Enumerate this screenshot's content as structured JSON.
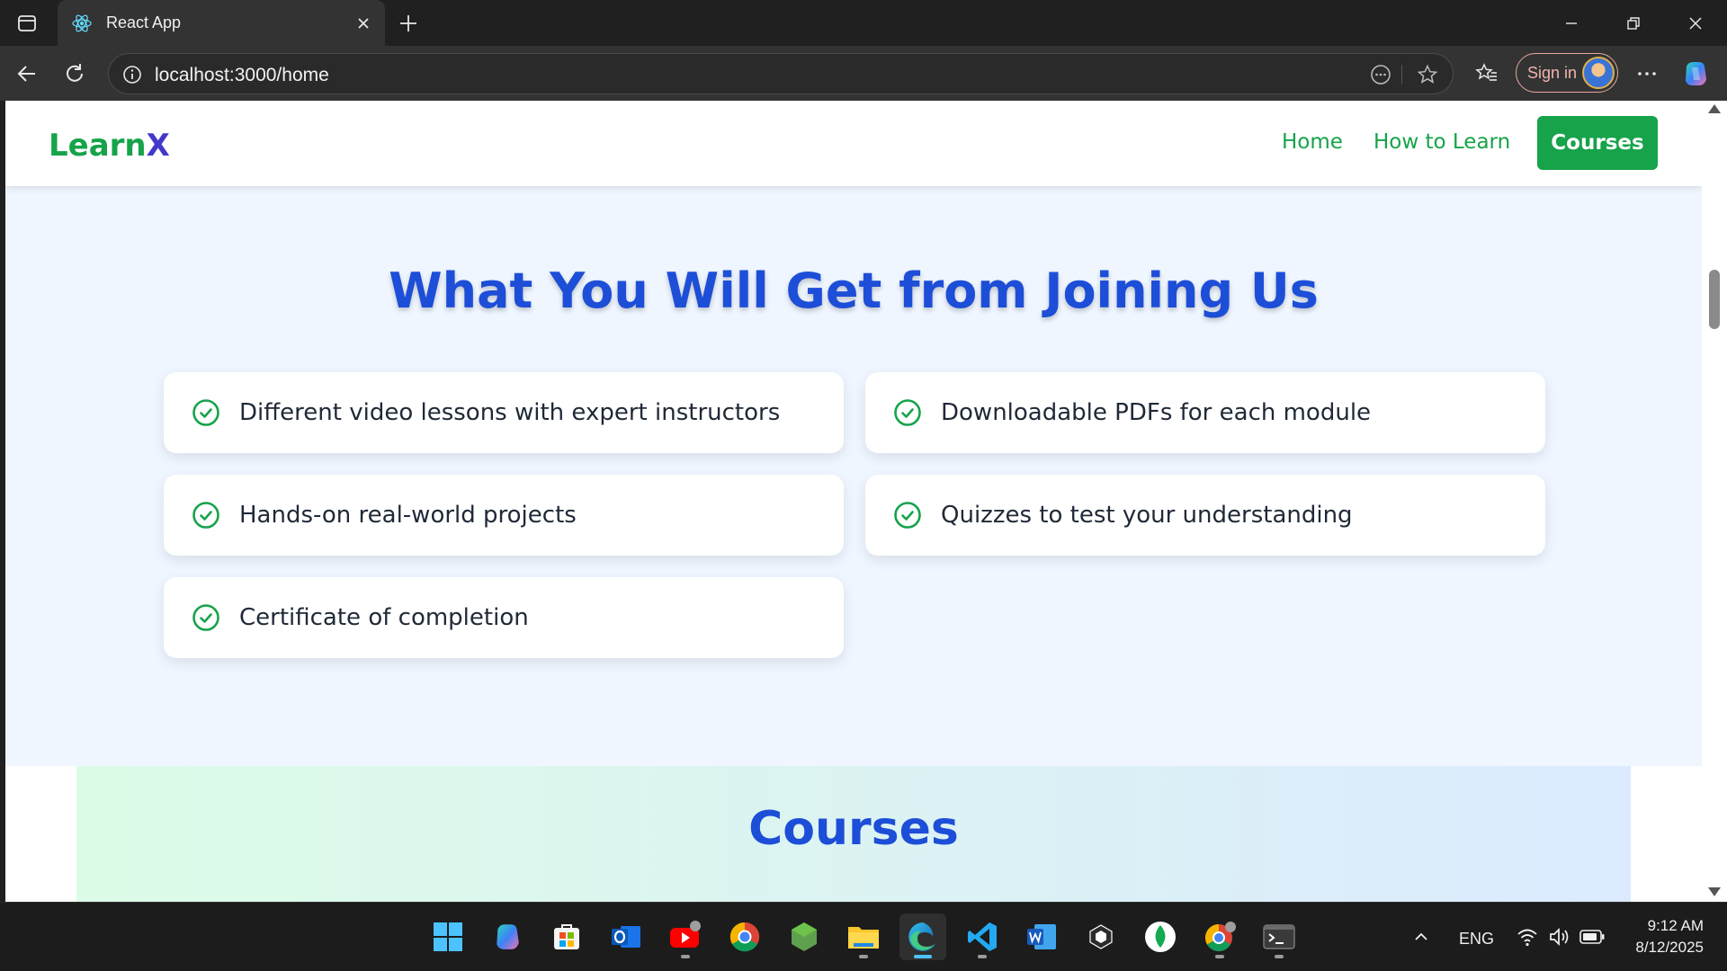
{
  "browser": {
    "tab_title": "React App",
    "url": "localhost:3000/home",
    "signin_label": "Sign in"
  },
  "navbar": {
    "logo_part1": "Learn",
    "logo_part2": "X",
    "links": [
      {
        "label": "Home"
      },
      {
        "label": "How to Learn"
      }
    ],
    "cta_label": "Courses"
  },
  "benefits": {
    "title": "What You Will Get from Joining Us",
    "items": [
      {
        "text": "Different video lessons with expert instructors"
      },
      {
        "text": "Downloadable PDFs for each module"
      },
      {
        "text": "Hands-on real-world projects"
      },
      {
        "text": "Quizzes to test your understanding"
      },
      {
        "text": "Certificate of completion"
      }
    ]
  },
  "courses": {
    "title": "Courses"
  },
  "taskbar": {
    "language": "ENG",
    "time": "9:12 AM",
    "date": "8/12/2025"
  },
  "colors": {
    "brand_green": "#16a34a",
    "brand_blue": "#1d4ed8",
    "logo_x": "#4338ca",
    "page_bg": "#eff6ff"
  }
}
